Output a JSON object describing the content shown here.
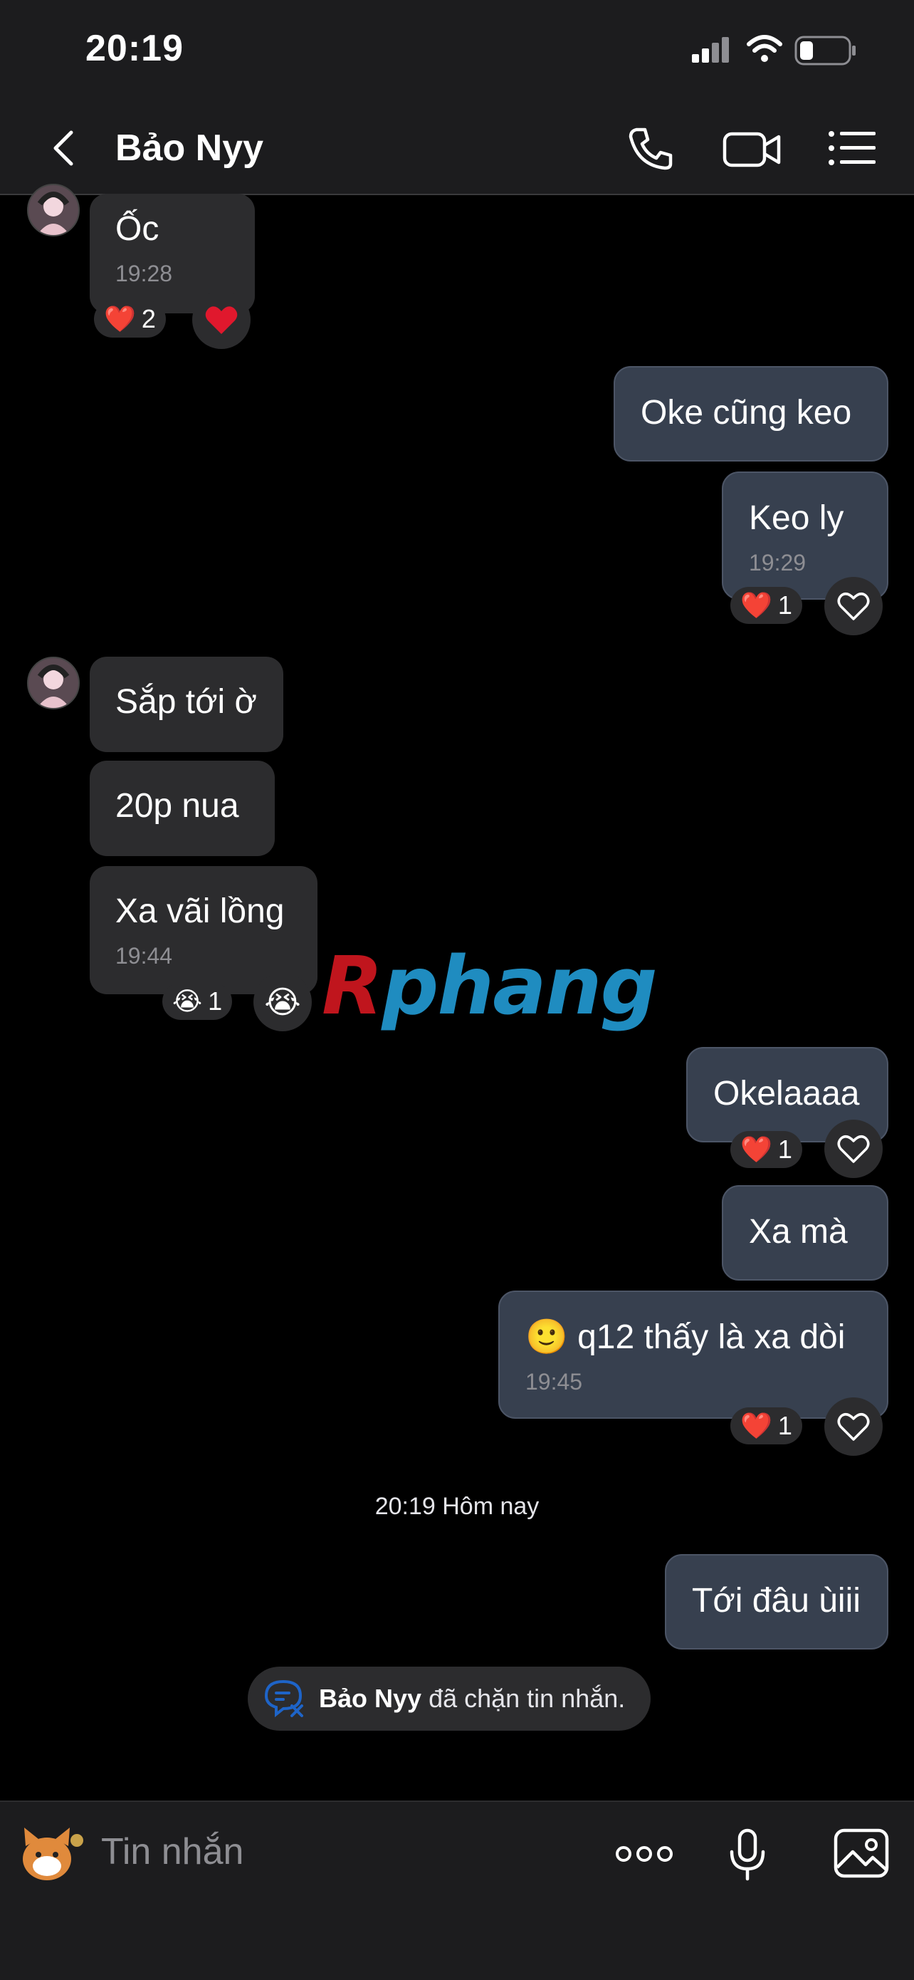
{
  "status": {
    "time": "20:19"
  },
  "header": {
    "title": "Bảo Nyy"
  },
  "messages": {
    "m1": {
      "text": "Ốc",
      "time": "19:28",
      "reaction": "❤️",
      "count": "2"
    },
    "m2": {
      "text": "Oke cũng keo"
    },
    "m3": {
      "text": "Keo ly",
      "time": "19:29",
      "reaction": "❤️",
      "count": "1"
    },
    "m4": {
      "text": "Sắp tới ờ"
    },
    "m5": {
      "text": "20p nua"
    },
    "m6": {
      "text": "Xa vãi lồng",
      "time": "19:44",
      "reaction": "😭",
      "count": "1"
    },
    "m7": {
      "text": "Okelaaaa",
      "reaction": "❤️",
      "count": "1"
    },
    "m8": {
      "text": "Xa mà"
    },
    "m9": {
      "emoji": "🙂",
      "text": "q12 thấy là xa dòi",
      "time": "19:45",
      "reaction": "❤️",
      "count": "1"
    },
    "m10": {
      "text": "Tới đâu ùiii"
    }
  },
  "date_separator": "20:19 Hôm nay",
  "system_notice": {
    "name": "Bảo Nyy",
    "text": "đã chặn tin nhắn."
  },
  "watermark": {
    "first": "R",
    "rest": "phang"
  },
  "input": {
    "placeholder": "Tin nhắn"
  },
  "colors": {
    "incoming": "#2c2c2e",
    "outgoing": "#37404f",
    "heart": "#e0182d",
    "blocked_icon": "#1e64c8"
  },
  "icons": [
    "back-icon",
    "phone-icon",
    "video-icon",
    "menu-icon",
    "heart-outline-icon",
    "sticker-icon",
    "more-icon",
    "mic-icon",
    "image-icon",
    "blocked-chat-icon"
  ]
}
